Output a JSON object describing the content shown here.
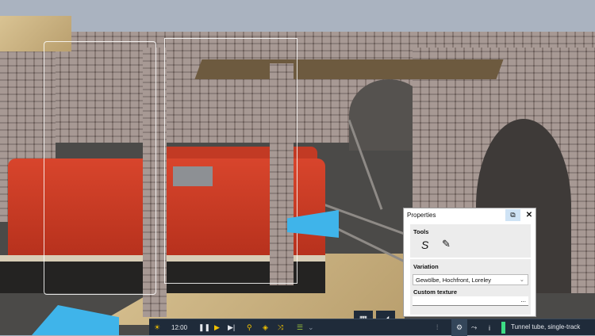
{
  "properties_panel": {
    "title": "Properties",
    "popout_icon": "popout-icon",
    "close_icon": "close-icon",
    "tools": {
      "label": "Tools",
      "items": [
        {
          "icon": "track-curve-icon"
        },
        {
          "icon": "pencil-icon"
        }
      ]
    },
    "variation": {
      "label": "Variation",
      "value": "Gewölbe, Hochfront, Loreley"
    },
    "custom_texture": {
      "label": "Custom texture",
      "value": "",
      "browse_label": "..."
    }
  },
  "toolbar": {
    "time": "12:00",
    "status": "Tunnel tube, single-track",
    "status_color": "#3ddc84",
    "icons": [
      "sun-icon",
      "pause-icon",
      "play-icon",
      "step-icon",
      "search-icon",
      "layers-icon",
      "shuffle-icon",
      "schedule-icon",
      "chevron-down-icon",
      "windows-icon",
      "terrain-icon",
      "sliders-icon",
      "gear-icon",
      "track-tool-icon",
      "info-icon"
    ]
  },
  "colors": {
    "toolbar_bg": "#1f2b3a",
    "accent_yellow": "#f2c200",
    "panel_highlight": "#cfe3f5"
  }
}
